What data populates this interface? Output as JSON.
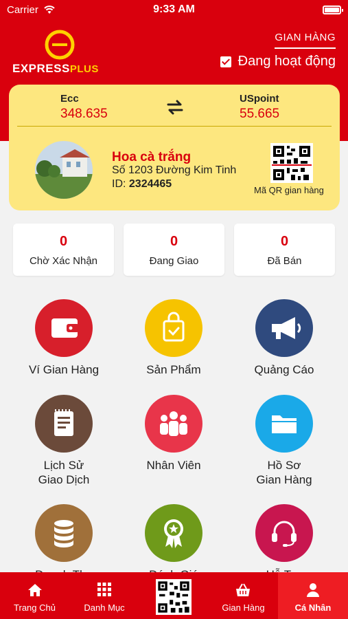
{
  "status_bar": {
    "carrier": "Carrier",
    "time": "9:33 AM"
  },
  "brand": {
    "name_main": "EXPRESS",
    "name_plus": "PLUS"
  },
  "header": {
    "store_tab": "GIAN HÀNG",
    "active_label": "Đang hoạt động",
    "active_checked": true
  },
  "points": {
    "ecc_label": "Ecc",
    "ecc_value": "348.635",
    "uspoint_label": "USpoint",
    "uspoint_value": "55.665"
  },
  "store": {
    "name": "Hoa cà trắng",
    "address": "Số 1203 Đường Kim Tinh",
    "id_label": "ID:",
    "id_value": "2324465",
    "qr_caption": "Mã QR gian hàng"
  },
  "order_stats": [
    {
      "count": "0",
      "label": "Chờ Xác Nhận"
    },
    {
      "count": "0",
      "label": "Đang Giao"
    },
    {
      "count": "0",
      "label": "Đã Bán"
    }
  ],
  "menu": [
    {
      "label": "Ví Gian Hàng",
      "icon": "wallet-icon",
      "color": "#d71f2b"
    },
    {
      "label": "Sản Phẩm",
      "icon": "shopping-bag-icon",
      "color": "#f6c300"
    },
    {
      "label": "Quảng Cáo",
      "icon": "megaphone-icon",
      "color": "#2f4a7e"
    },
    {
      "label": "Lịch Sử\nGiao Dịch",
      "icon": "clipboard-icon",
      "color": "#6b4a3a"
    },
    {
      "label": "Nhân Viên",
      "icon": "people-icon",
      "color": "#e8354a"
    },
    {
      "label": "Hồ Sơ\nGian Hàng",
      "icon": "folder-icon",
      "color": "#1aa9e8"
    },
    {
      "label": "Doanh Thu",
      "icon": "database-icon",
      "color": "#a0703a"
    },
    {
      "label": "Đánh Giá",
      "icon": "award-icon",
      "color": "#6f9a1a"
    },
    {
      "label": "Hỗ Trợ",
      "icon": "headset-icon",
      "color": "#c8164f"
    }
  ],
  "tabbar": [
    {
      "label": "Trang Chủ",
      "icon": "home-icon"
    },
    {
      "label": "Danh Mục",
      "icon": "grid-icon"
    },
    {
      "label": "",
      "icon": "qr-code-icon"
    },
    {
      "label": "Gian Hàng",
      "icon": "basket-icon"
    },
    {
      "label": "Cá Nhân",
      "icon": "person-icon",
      "active": true
    }
  ],
  "colors": {
    "primary": "#d9000d",
    "card": "#fde77f",
    "accent_yellow": "#ffd100"
  }
}
